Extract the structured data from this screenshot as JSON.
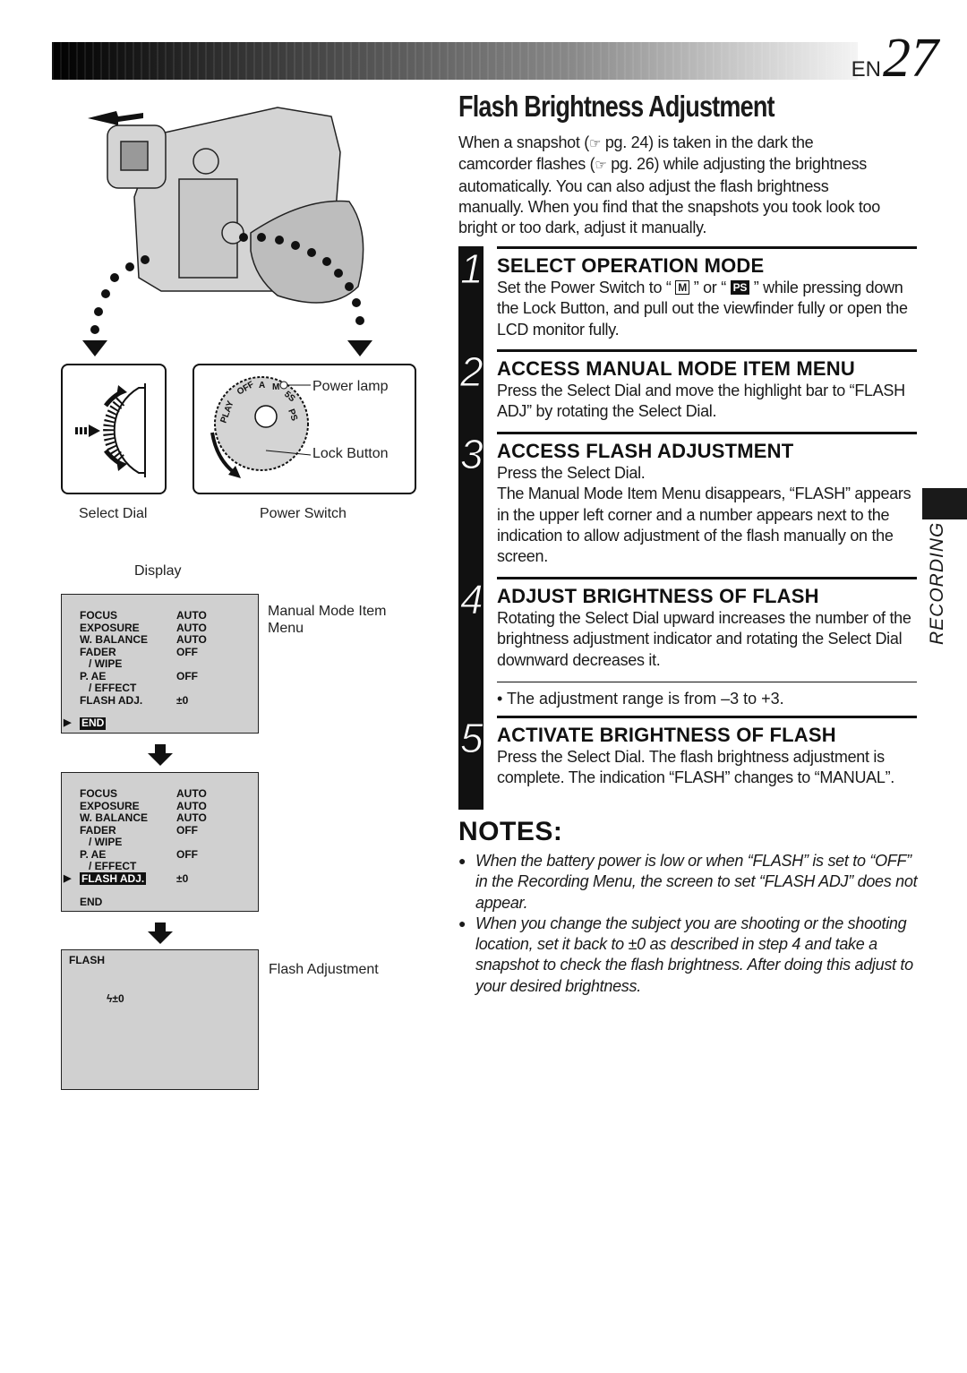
{
  "header": {
    "lang_code": "EN",
    "page_number": "27"
  },
  "title": "Flash Brightness Adjustment",
  "intro": {
    "part1": "When a snapshot (",
    "ref1_icon": "reference-hand-icon",
    "part2": " pg. 24) is taken in the dark the camcorder flashes (",
    "ref2_icon": "reference-hand-icon",
    "part3": " pg. 26) while adjusting the brightness automatically. You can also adjust the flash brightness manually. When you find that the snapshots you took look too bright or too dark, adjust it manually."
  },
  "steps": [
    {
      "number": "1",
      "heading": "SELECT OPERATION MODE",
      "text_a": "Set the Power Switch to “ ",
      "badge_m": "M",
      "text_b": " ” or “ ",
      "badge_ps": "PS",
      "text_c": " ” while pressing down the Lock Button, and pull out the viewfinder fully or open the LCD monitor fully."
    },
    {
      "number": "2",
      "heading": "ACCESS MANUAL MODE ITEM MENU",
      "text": "Press the Select Dial and move the highlight bar to “FLASH ADJ” by rotating the Select Dial."
    },
    {
      "number": "3",
      "heading": "ACCESS FLASH ADJUSTMENT",
      "text_line1": "Press the Select Dial.",
      "text": "The Manual Mode Item Menu disappears, “FLASH” appears in the upper left corner and a number appears next to the indication to allow adjustment of the flash manually on the screen."
    },
    {
      "number": "4",
      "heading": "ADJUST BRIGHTNESS OF FLASH",
      "text": "Rotating the Select Dial upward increases the number of the brightness adjustment indicator and rotating the Select Dial downward decreases it.",
      "bullet": "• The adjustment range is from –3 to +3."
    },
    {
      "number": "5",
      "heading": "ACTIVATE BRIGHTNESS OF FLASH",
      "text": "Press the Select Dial. The flash brightness adjustment is complete. The indication “FLASH” changes to “MANUAL”."
    }
  ],
  "notes": {
    "heading": "NOTES:",
    "items": [
      "When the battery power is low or when “FLASH” is set to “OFF” in the Recording Menu, the screen to set “FLASH ADJ” does not appear.",
      "When you change the subject you are shooting or the shooting location, set it back to ±0 as described in step 4 and take a snapshot to check the flash brightness. After doing this adjust to your desired brightness."
    ]
  },
  "side_tab": {
    "label": "RECORDING"
  },
  "figures": {
    "select_dial_caption": "Select Dial",
    "power_switch_caption": "Power Switch",
    "power_lamp_label": "Power lamp",
    "lock_button_label": "Lock Button",
    "dial_marks": [
      "PLAY",
      "OFF",
      "A",
      "M",
      "5S",
      "PS"
    ],
    "display_caption": "Display",
    "menu_caption": "Manual Mode Item Menu",
    "flash_caption": "Flash Adjustment"
  },
  "screen1": {
    "rows": [
      {
        "k": "FOCUS",
        "v": "AUTO"
      },
      {
        "k": "EXPOSURE",
        "v": "AUTO"
      },
      {
        "k": "W. BALANCE",
        "v": "AUTO"
      },
      {
        "k": "FADER",
        "v": "OFF"
      },
      {
        "k": "/ WIPE",
        "v": ""
      },
      {
        "k": "P. AE",
        "v": "OFF"
      },
      {
        "k": "/ EFFECT",
        "v": ""
      },
      {
        "k": "FLASH ADJ.",
        "v": "±0"
      }
    ],
    "end": "END",
    "highlighted": "END"
  },
  "screen2": {
    "rows": [
      {
        "k": "FOCUS",
        "v": "AUTO"
      },
      {
        "k": "EXPOSURE",
        "v": "AUTO"
      },
      {
        "k": "W. BALANCE",
        "v": "AUTO"
      },
      {
        "k": "FADER",
        "v": "OFF"
      },
      {
        "k": "/ WIPE",
        "v": ""
      },
      {
        "k": "P. AE",
        "v": "OFF"
      },
      {
        "k": "/ EFFECT",
        "v": ""
      },
      {
        "k": "FLASH ADJ.",
        "v": "±0"
      }
    ],
    "end": "END",
    "highlighted": "FLASH ADJ."
  },
  "screen3": {
    "label": "FLASH",
    "value": "ϟ±0"
  }
}
